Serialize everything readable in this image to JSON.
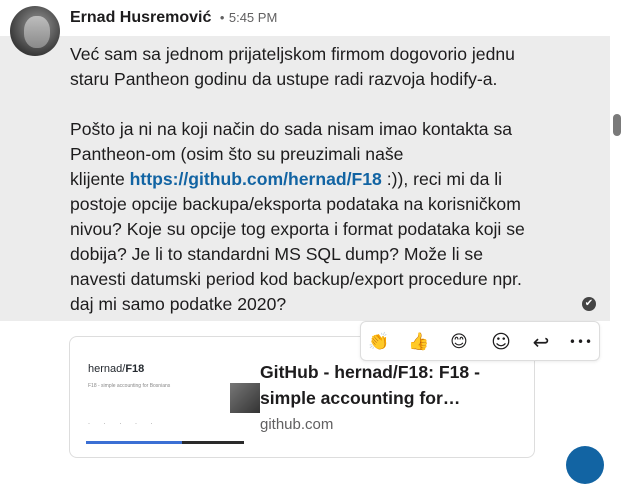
{
  "message": {
    "author": "Ernad Husremović",
    "separator": "•",
    "time": "5:45 PM",
    "paragraph1_lines": [
      "Već sam sa jednom prijateljskom firmom dogovorio jednu",
      "staru Pantheon godinu da ustupe radi razvoja hodify-a."
    ],
    "paragraph2_lines": [
      "Pošto ja ni na koji način do sada nisam imao kontakta sa",
      "Pantheon-om (osim što su preuzimali naše"
    ],
    "paragraph2_prefix": "klijente ",
    "paragraph2_link": "https://github.com/hernad/F18",
    "paragraph2_suffix": " :)), reci mi da li",
    "paragraph2_rest": [
      "postoje opcije backupa/eksporta podataka na korisničkom",
      "nivou? Koje su opcije tog exporta i format podataka koji se",
      "dobija? Je li to standardni MS SQL dump? Može li se",
      "navesti datumski period kod backup/export procedure npr.",
      "daj mi samo podatke 2020?"
    ]
  },
  "link_preview": {
    "title_line1": "GitHub - hernad/F18: F18 -",
    "title_line2": "simple accounting for…",
    "domain": "github.com",
    "image_title_owner": "hernad/",
    "image_title_repo": "F18",
    "image_subtitle": "F18 - simple accounting for Bosnians"
  },
  "toolbar": {
    "clap": "👏",
    "thumbs_up": "👍",
    "smile": "😊",
    "add_reaction": "☺",
    "reply": "↩",
    "more": "•••"
  },
  "icons": {
    "sent": "✔"
  },
  "colors": {
    "link": "#1264a3",
    "message_bg": "#ececec"
  }
}
